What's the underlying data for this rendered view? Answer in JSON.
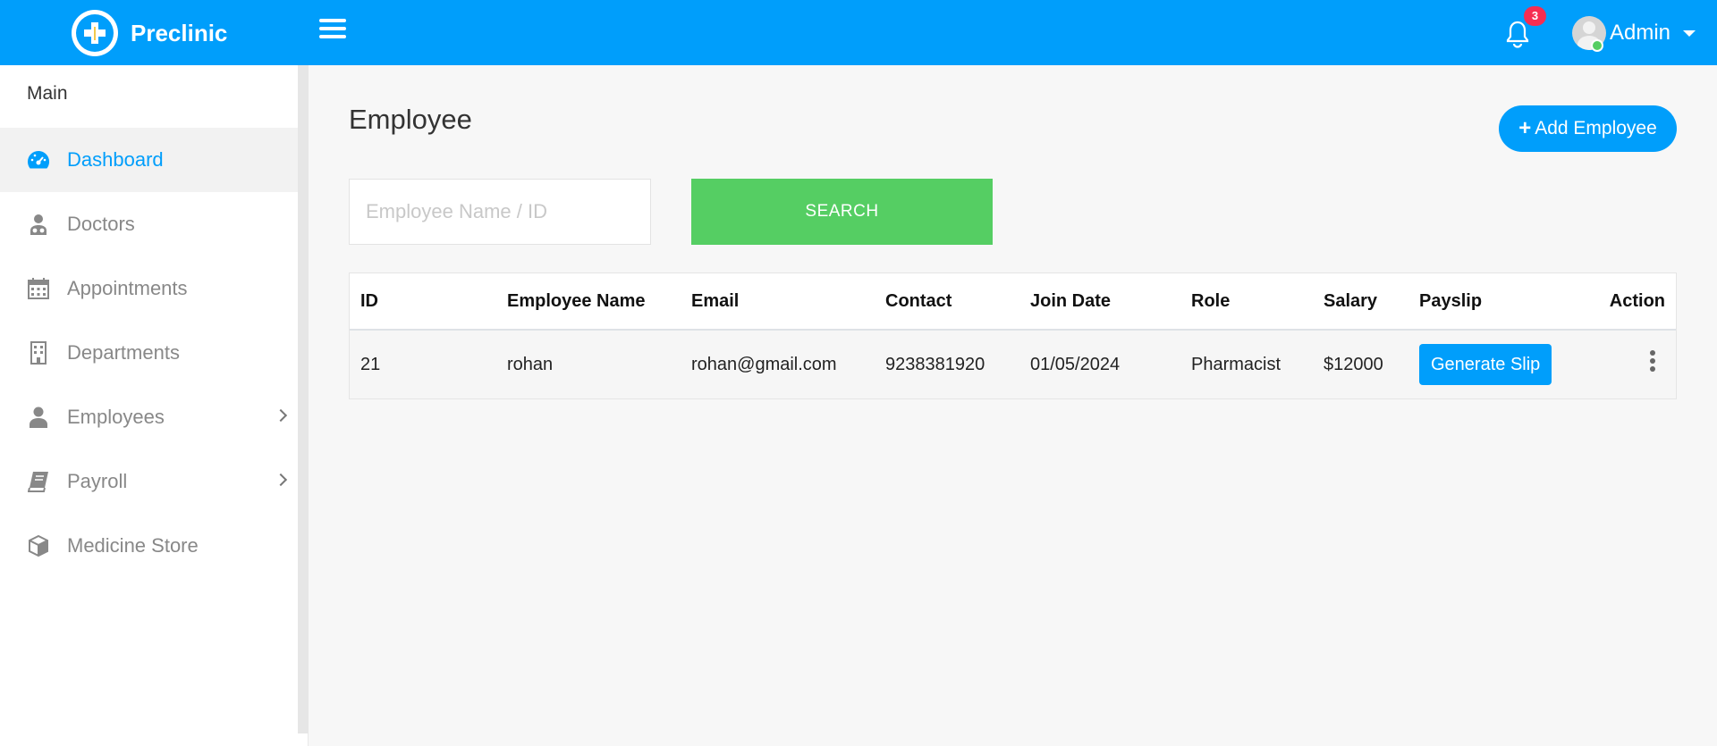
{
  "app": {
    "name": "Preclinic",
    "notification_count": "3",
    "user_name": "Admin"
  },
  "sidebar": {
    "section_title": "Main",
    "items": [
      {
        "label": "Dashboard",
        "icon": "dashboard-gauge-icon",
        "active": true
      },
      {
        "label": "Doctors",
        "icon": "doctor-icon"
      },
      {
        "label": "Appointments",
        "icon": "calendar-icon"
      },
      {
        "label": "Departments",
        "icon": "building-icon"
      },
      {
        "label": "Employees",
        "icon": "user-icon",
        "has_submenu": true
      },
      {
        "label": "Payroll",
        "icon": "book-icon",
        "has_submenu": true
      },
      {
        "label": "Medicine Store",
        "icon": "cube-icon"
      }
    ]
  },
  "main": {
    "title": "Employee",
    "add_button_label": "Add Employee",
    "search": {
      "placeholder": "Employee Name / ID",
      "value": "",
      "button_label": "SEARCH"
    },
    "table": {
      "columns": [
        "ID",
        "Employee Name",
        "Email",
        "Contact",
        "Join Date",
        "Role",
        "Salary",
        "Payslip",
        "Action"
      ],
      "rows": [
        {
          "id": "21",
          "name": "rohan",
          "email": "rohan@gmail.com",
          "contact": "9238381920",
          "join_date": "01/05/2024",
          "role": "Pharmacist",
          "salary": "$12000",
          "payslip_button": "Generate Slip"
        }
      ]
    }
  },
  "colors": {
    "primary": "#009efb",
    "success": "#55ce63",
    "danger": "#f62d51"
  }
}
